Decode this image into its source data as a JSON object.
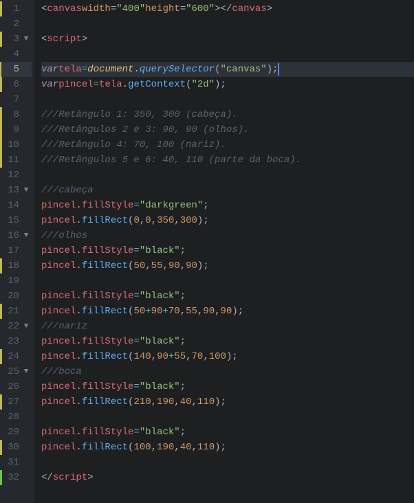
{
  "lines": [
    {
      "n": 1,
      "fold": "",
      "mod": "y",
      "html": "<span class='t-angle'>&lt;</span><span class='t-tag'>canvas</span> <span class='t-attr'>width</span><span class='t-punc'>=</span><span class='t-str'>\"400\"</span> <span class='t-attr'>height</span><span class='t-punc'>=</span><span class='t-str'>\"600\"</span><span class='t-angle'>&gt;</span> <span class='t-angle'>&lt;/</span><span class='t-tag'>canvas</span><span class='t-angle'>&gt;</span>"
    },
    {
      "n": 2,
      "fold": "",
      "mod": "",
      "html": ""
    },
    {
      "n": 3,
      "fold": "▼",
      "mod": "y",
      "html": "<span class='t-angle'>&lt;</span><span class='t-tag'>script</span><span class='t-angle'>&gt;</span>"
    },
    {
      "n": 4,
      "fold": "",
      "mod": "",
      "html": ""
    },
    {
      "n": 5,
      "fold": "",
      "mod": "y",
      "hl": true,
      "html": "    <span class='t-keyword'>var</span> <span class='t-var'>tela</span> <span class='t-op'>=</span> <span class='t-doc'>document</span><span class='t-punc'>.</span><span class='t-funcI'>querySelector</span><span class='t-punc'>(</span><span class='t-str'>\"canvas\"</span><span class='t-punc'>);</span><span class='cursor'></span>"
    },
    {
      "n": 6,
      "fold": "",
      "mod": "y",
      "html": "    <span class='t-keyword'>var</span> <span class='t-var'>pincel</span> <span class='t-op'>=</span> <span class='t-var'>tela</span><span class='t-punc'>.</span><span class='t-func'>getContext</span><span class='t-punc'>(</span><span class='t-str'>\"2d\"</span><span class='t-punc'>);</span>"
    },
    {
      "n": 7,
      "fold": "",
      "mod": "",
      "html": ""
    },
    {
      "n": 8,
      "fold": "",
      "mod": "y",
      "html": "<span class='t-comment'>///Retângulo 1: 350, 300 (cabeça).</span>"
    },
    {
      "n": 9,
      "fold": "",
      "mod": "y",
      "html": "<span class='t-comment'>///Retângulos 2 e 3: 90, 90 (olhos).</span>"
    },
    {
      "n": 10,
      "fold": "",
      "mod": "y",
      "html": "<span class='t-comment'>///Retângulo 4: 70, 100 (nariz).</span>"
    },
    {
      "n": 11,
      "fold": "",
      "mod": "y",
      "html": "<span class='t-comment'>///Retângulos 5 e 6: 40, 110 (parte da boca).</span>"
    },
    {
      "n": 12,
      "fold": "",
      "mod": "",
      "html": ""
    },
    {
      "n": 13,
      "fold": "▼",
      "mod": "",
      "html": "<span class='t-comment'>///cabeça</span>"
    },
    {
      "n": 14,
      "fold": "",
      "mod": "",
      "html": "    <span class='t-var'>pincel</span><span class='t-punc'>.</span><span class='t-var'>fillStyle</span> <span class='t-op'>=</span> <span class='t-str'>\"darkgreen\"</span><span class='t-punc'>;</span>"
    },
    {
      "n": 15,
      "fold": "",
      "mod": "",
      "html": "    <span class='t-var'>pincel</span><span class='t-punc'>.</span><span class='t-func'>fillRect</span> <span class='t-punc'>(</span><span class='t-num'>0</span><span class='t-punc'>,</span><span class='t-num'>0</span><span class='t-punc'>,</span> <span class='t-num'>350</span><span class='t-punc'>,</span><span class='t-num'>300</span><span class='t-punc'>);</span>"
    },
    {
      "n": 16,
      "fold": "▼",
      "mod": "",
      "html": "<span class='t-comment'>///olhos</span>"
    },
    {
      "n": 17,
      "fold": "",
      "mod": "",
      "html": "    <span class='t-var'>pincel</span><span class='t-punc'>.</span><span class='t-var'>fillStyle</span> <span class='t-op'>=</span> <span class='t-str'>\"black\"</span><span class='t-punc'>;</span>"
    },
    {
      "n": 18,
      "fold": "",
      "mod": "y",
      "html": "    <span class='t-var'>pincel</span><span class='t-punc'>.</span><span class='t-func'>fillRect</span> <span class='t-punc'>(</span><span class='t-num'>50</span><span class='t-punc'>,</span><span class='t-num'>55</span><span class='t-punc'>,</span> <span class='t-num'>90</span><span class='t-punc'>,</span><span class='t-num'>90</span><span class='t-punc'>);</span>"
    },
    {
      "n": 19,
      "fold": "",
      "mod": "",
      "html": ""
    },
    {
      "n": 20,
      "fold": "",
      "mod": "",
      "html": "    <span class='t-var'>pincel</span><span class='t-punc'>.</span><span class='t-var'>fillStyle</span> <span class='t-op'>=</span> <span class='t-str'>\"black\"</span><span class='t-punc'>;</span>"
    },
    {
      "n": 21,
      "fold": "",
      "mod": "y",
      "html": "    <span class='t-var'>pincel</span><span class='t-punc'>.</span><span class='t-func'>fillRect</span> <span class='t-punc'>(</span><span class='t-num'>50</span><span class='t-op'>+</span><span class='t-num'>90</span><span class='t-op'>+</span><span class='t-num'>70</span><span class='t-punc'>,</span><span class='t-num'>55</span><span class='t-punc'>,</span> <span class='t-num'>90</span><span class='t-punc'>,</span><span class='t-num'>90</span><span class='t-punc'>);</span>"
    },
    {
      "n": 22,
      "fold": "▼",
      "mod": "",
      "html": "<span class='t-comment'>///nariz</span>"
    },
    {
      "n": 23,
      "fold": "",
      "mod": "",
      "html": "    <span class='t-var'>pincel</span><span class='t-punc'>.</span><span class='t-var'>fillStyle</span> <span class='t-op'>=</span> <span class='t-str'>\"black\"</span><span class='t-punc'>;</span>"
    },
    {
      "n": 24,
      "fold": "",
      "mod": "y",
      "html": "    <span class='t-var'>pincel</span><span class='t-punc'>.</span><span class='t-func'>fillRect</span> <span class='t-punc'>(</span><span class='t-num'>140</span><span class='t-punc'>,</span><span class='t-num'>90</span><span class='t-op'>+</span><span class='t-num'>55</span><span class='t-punc'>,</span> <span class='t-num'>70</span><span class='t-punc'>,</span><span class='t-num'>100</span><span class='t-punc'>);</span>"
    },
    {
      "n": 25,
      "fold": "▼",
      "mod": "",
      "html": "<span class='t-comment'>///boca</span>"
    },
    {
      "n": 26,
      "fold": "",
      "mod": "",
      "html": "    <span class='t-var'>pincel</span><span class='t-punc'>.</span><span class='t-var'>fillStyle</span> <span class='t-op'>=</span> <span class='t-str'>\"black\"</span><span class='t-punc'>;</span>"
    },
    {
      "n": 27,
      "fold": "",
      "mod": "y",
      "html": "    <span class='t-var'>pincel</span><span class='t-punc'>.</span><span class='t-func'>fillRect</span> <span class='t-punc'>(</span><span class='t-num'>210</span><span class='t-punc'>,</span><span class='t-num'>190</span><span class='t-punc'>,</span> <span class='t-num'>40</span><span class='t-punc'>,</span><span class='t-num'>110</span><span class='t-punc'>);</span>"
    },
    {
      "n": 28,
      "fold": "",
      "mod": "",
      "html": ""
    },
    {
      "n": 29,
      "fold": "",
      "mod": "",
      "html": "    <span class='t-var'>pincel</span><span class='t-punc'>.</span><span class='t-var'>fillStyle</span> <span class='t-op'>=</span> <span class='t-str'>\"black\"</span><span class='t-punc'>;</span>"
    },
    {
      "n": 30,
      "fold": "",
      "mod": "y",
      "html": "    <span class='t-var'>pincel</span><span class='t-punc'>.</span><span class='t-func'>fillRect</span> <span class='t-punc'>(</span><span class='t-num'>100</span><span class='t-punc'>,</span><span class='t-num'>190</span><span class='t-punc'>,</span> <span class='t-num'>40</span><span class='t-punc'>,</span><span class='t-num'>110</span><span class='t-punc'>);</span>"
    },
    {
      "n": 31,
      "fold": "",
      "mod": "",
      "html": ""
    },
    {
      "n": 32,
      "fold": "",
      "mod": "g",
      "html": "<span class='t-angle'>&lt;/</span><span class='t-tag'>script</span><span class='t-angle'>&gt;</span>"
    }
  ],
  "indent": "    "
}
